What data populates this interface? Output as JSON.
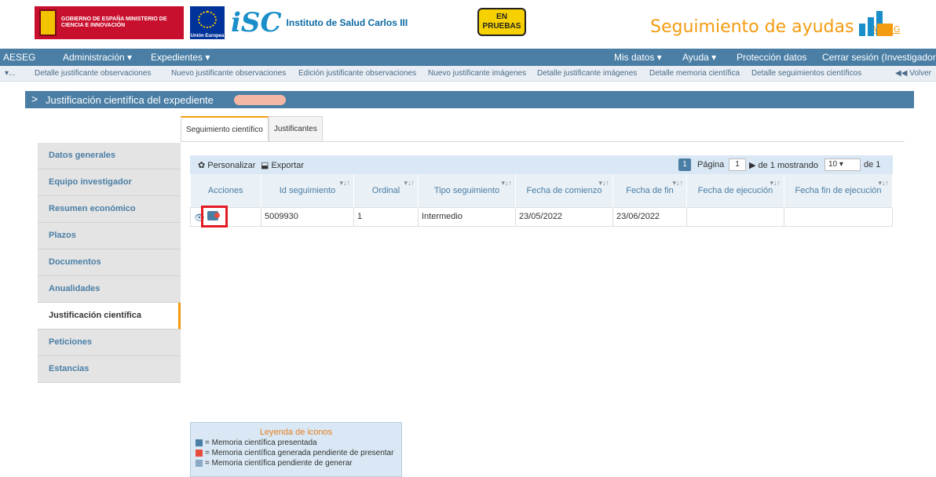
{
  "header": {
    "gob_text": "GOBIERNO DE ESPAÑA  MINISTERIO DE CIENCIA E INNOVACIÓN",
    "eu_text": "Unión Europea",
    "isciii_mark": "iSC",
    "isciii_name": "Instituto de Salud Carlos III",
    "enpruebas": "EN PRUEBAS",
    "app_title": "Seguimiento de ayudas - ",
    "app_acr": "AESEG"
  },
  "nav": {
    "brand": "AESEG",
    "admin": "Administración ▾",
    "expedientes": "Expedientes ▾",
    "mis_datos": "Mis datos ▾",
    "ayuda": "Ayuda ▾",
    "proteccion": "Protección datos",
    "cerrar": "Cerrar sesión (Investigador)"
  },
  "breadcrumbs": [
    "▾...",
    "Detalle justificante observaciones",
    "Nuevo justificante observaciones",
    "Edición justificante observaciones",
    "Nuevo justificante imágenes",
    "Detalle justificante imágenes",
    "Detalle memoria científica",
    "Detalle seguimientos científicos"
  ],
  "volver": "◀◀ Volver",
  "section_title": "Justificación científica del expediente",
  "tabs": [
    "Seguimiento científico",
    "Justificantes"
  ],
  "sidebar": [
    "Datos generales",
    "Equipo investigador",
    "Resumen económico",
    "Plazos",
    "Documentos",
    "Anualidades",
    "Justificación científica",
    "Peticiones",
    "Estancias"
  ],
  "toolbar": {
    "personalizar": "✿ Personalizar",
    "exportar": "⬓ Exportar",
    "page_badge": "1",
    "pagina": "Página",
    "page_value": "1",
    "de_1": "▶ de 1 mostrando",
    "page_size": "10 ▾",
    "de_1b": "de 1"
  },
  "table": {
    "headers": [
      "Acciones",
      "Id seguimiento",
      "Ordinal",
      "Tipo seguimiento",
      "Fecha de comienzo",
      "Fecha de fin",
      "Fecha de ejecución",
      "Fecha fin de ejecución"
    ],
    "rows": [
      [
        "",
        "5009930",
        "1",
        "Intermedio",
        "23/05/2022",
        "23/06/2022",
        "",
        ""
      ]
    ]
  },
  "legend": {
    "title": "Leyenda de iconos",
    "items": [
      "= Memoria científica presentada",
      "= Memoria científica generada pendiente de presentar",
      "= Memoria científica pendiente de generar"
    ]
  }
}
